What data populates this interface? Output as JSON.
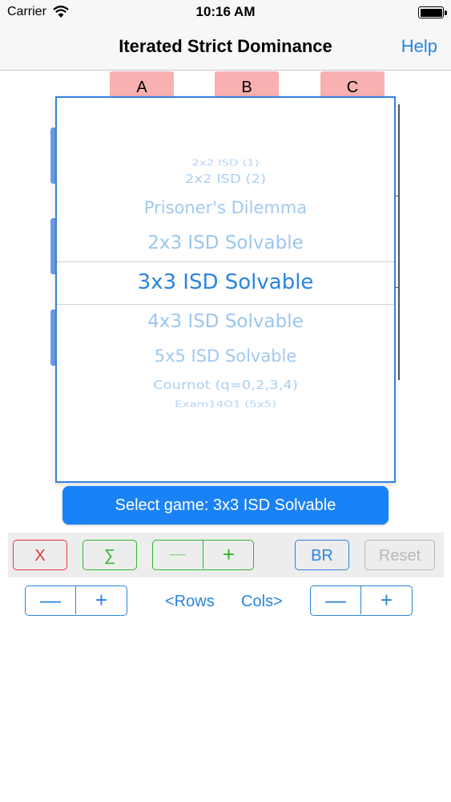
{
  "status_bar": {
    "carrier": "Carrier",
    "time": "10:16 AM"
  },
  "nav": {
    "title": "Iterated Strict Dominance",
    "help_label": "Help"
  },
  "matrix": {
    "column_headers": [
      "A",
      "B",
      "C"
    ]
  },
  "picker": {
    "items": [
      "2x2 ISD (1)",
      "2x2 ISD (2)",
      "Prisoner's Dilemma",
      "2x3 ISD Solvable",
      "3x3 ISD Solvable",
      "4x3 ISD Solvable",
      "5x5 ISD Solvable",
      "Cournot (q=0,2,3,4)",
      "Exam14O1 (5x5)"
    ],
    "selected": "3x3 ISD Solvable",
    "select_button_label": "Select game: 3x3 ISD Solvable"
  },
  "toolbar": {
    "x_label": "X",
    "sum_label": "∑",
    "minus_label": "—",
    "plus_label": "+",
    "br_label": "BR",
    "reset_label": "Reset"
  },
  "dimensions": {
    "rows_minus": "—",
    "rows_plus": "+",
    "rows_label": "<Rows",
    "cols_label": "Cols>",
    "cols_minus": "—",
    "cols_plus": "+"
  },
  "colors": {
    "accent": "#2a84e0",
    "select_button": "#1a82f7",
    "header_pink": "#f9b0b0",
    "danger": "#e03a3a",
    "success": "#2db52d"
  }
}
